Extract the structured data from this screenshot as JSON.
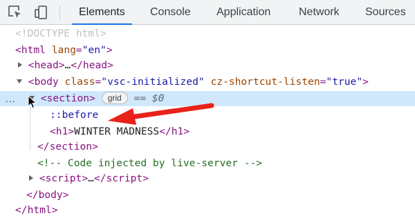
{
  "toolbar": {
    "inspect_icon": "inspect-element-icon",
    "device_icon": "device-toolbar-icon",
    "tabs": [
      {
        "label": "Elements",
        "active": true
      },
      {
        "label": "Console",
        "active": false
      },
      {
        "label": "Application",
        "active": false
      },
      {
        "label": "Network",
        "active": false
      },
      {
        "label": "Sources",
        "active": false
      }
    ]
  },
  "tree": {
    "doctype": "<!DOCTYPE html>",
    "html_open": {
      "tag": "html",
      "attr_name": "lang",
      "attr_value": "\"en\""
    },
    "head": {
      "tag": "head",
      "ellipsis": "…"
    },
    "body_open": {
      "tag": "body",
      "attr1_name": "class",
      "attr1_value": "\"vsc-initialized\"",
      "attr2_name": "cz-shortcut-listen",
      "attr2_value": "\"true\""
    },
    "section": {
      "tag": "section",
      "badge": "grid",
      "selection_marker": "== $0",
      "more_menu": "..."
    },
    "pseudo": "::before",
    "h1": {
      "tag": "h1",
      "text": "WINTER MADNESS"
    },
    "section_close": "section",
    "comment": "<!-- Code injected by live-server -->",
    "script": {
      "tag": "script",
      "ellipsis": "…"
    },
    "body_close": "body",
    "html_close": "html"
  },
  "annotation": {
    "arrow_color": "#e8221b"
  },
  "colors": {
    "tag": "#881280",
    "attr_name": "#994500",
    "attr_value": "#1a1aa6",
    "comment": "#236e25",
    "selection": "#cfe8fc",
    "active_tab_underline": "#1a73e8"
  }
}
